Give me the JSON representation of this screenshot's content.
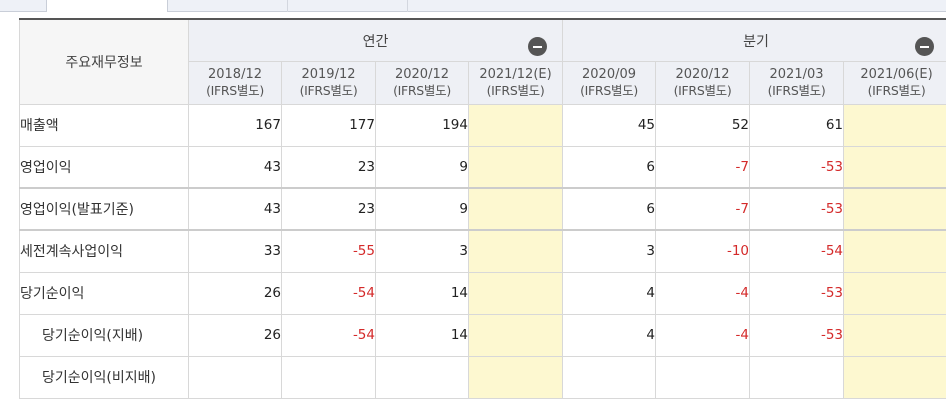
{
  "table": {
    "corner_label": "주요재무정보",
    "groups": [
      {
        "label": "연간",
        "collapse_icon": "minus-circle-icon"
      },
      {
        "label": "분기",
        "collapse_icon": "minus-circle-icon"
      }
    ],
    "periods": [
      {
        "period": "2018/12",
        "basis": "(IFRS별도)"
      },
      {
        "period": "2019/12",
        "basis": "(IFRS별도)"
      },
      {
        "period": "2020/12",
        "basis": "(IFRS별도)"
      },
      {
        "period": "2021/12(E)",
        "basis": "(IFRS별도)"
      },
      {
        "period": "2020/09",
        "basis": "(IFRS별도)"
      },
      {
        "period": "2020/12",
        "basis": "(IFRS별도)"
      },
      {
        "period": "2021/03",
        "basis": "(IFRS별도)"
      },
      {
        "period": "2021/06(E)",
        "basis": "(IFRS별도)"
      }
    ],
    "rows": [
      {
        "label": "매출액",
        "values": [
          "167",
          "177",
          "194",
          "",
          "45",
          "52",
          "61",
          ""
        ]
      },
      {
        "label": "영업이익",
        "values": [
          "43",
          "23",
          "9",
          "",
          "6",
          "-7",
          "-53",
          ""
        ]
      },
      {
        "label": "영업이익(발표기준)",
        "values": [
          "43",
          "23",
          "9",
          "",
          "6",
          "-7",
          "-53",
          ""
        ]
      },
      {
        "label": "세전계속사업이익",
        "values": [
          "33",
          "-55",
          "3",
          "",
          "3",
          "-10",
          "-54",
          ""
        ]
      },
      {
        "label": "당기순이익",
        "values": [
          "26",
          "-54",
          "14",
          "",
          "4",
          "-4",
          "-53",
          ""
        ]
      },
      {
        "label": "당기순이익(지배)",
        "values": [
          "26",
          "-54",
          "14",
          "",
          "4",
          "-4",
          "-53",
          ""
        ]
      },
      {
        "label": "당기순이익(비지배)",
        "values": [
          "",
          "",
          "",
          "",
          "",
          "",
          "",
          ""
        ]
      }
    ]
  },
  "colors": {
    "negative": "#d42a2a",
    "estimate_bg": "#fdf8d0",
    "header_bg": "#eef0f5"
  }
}
